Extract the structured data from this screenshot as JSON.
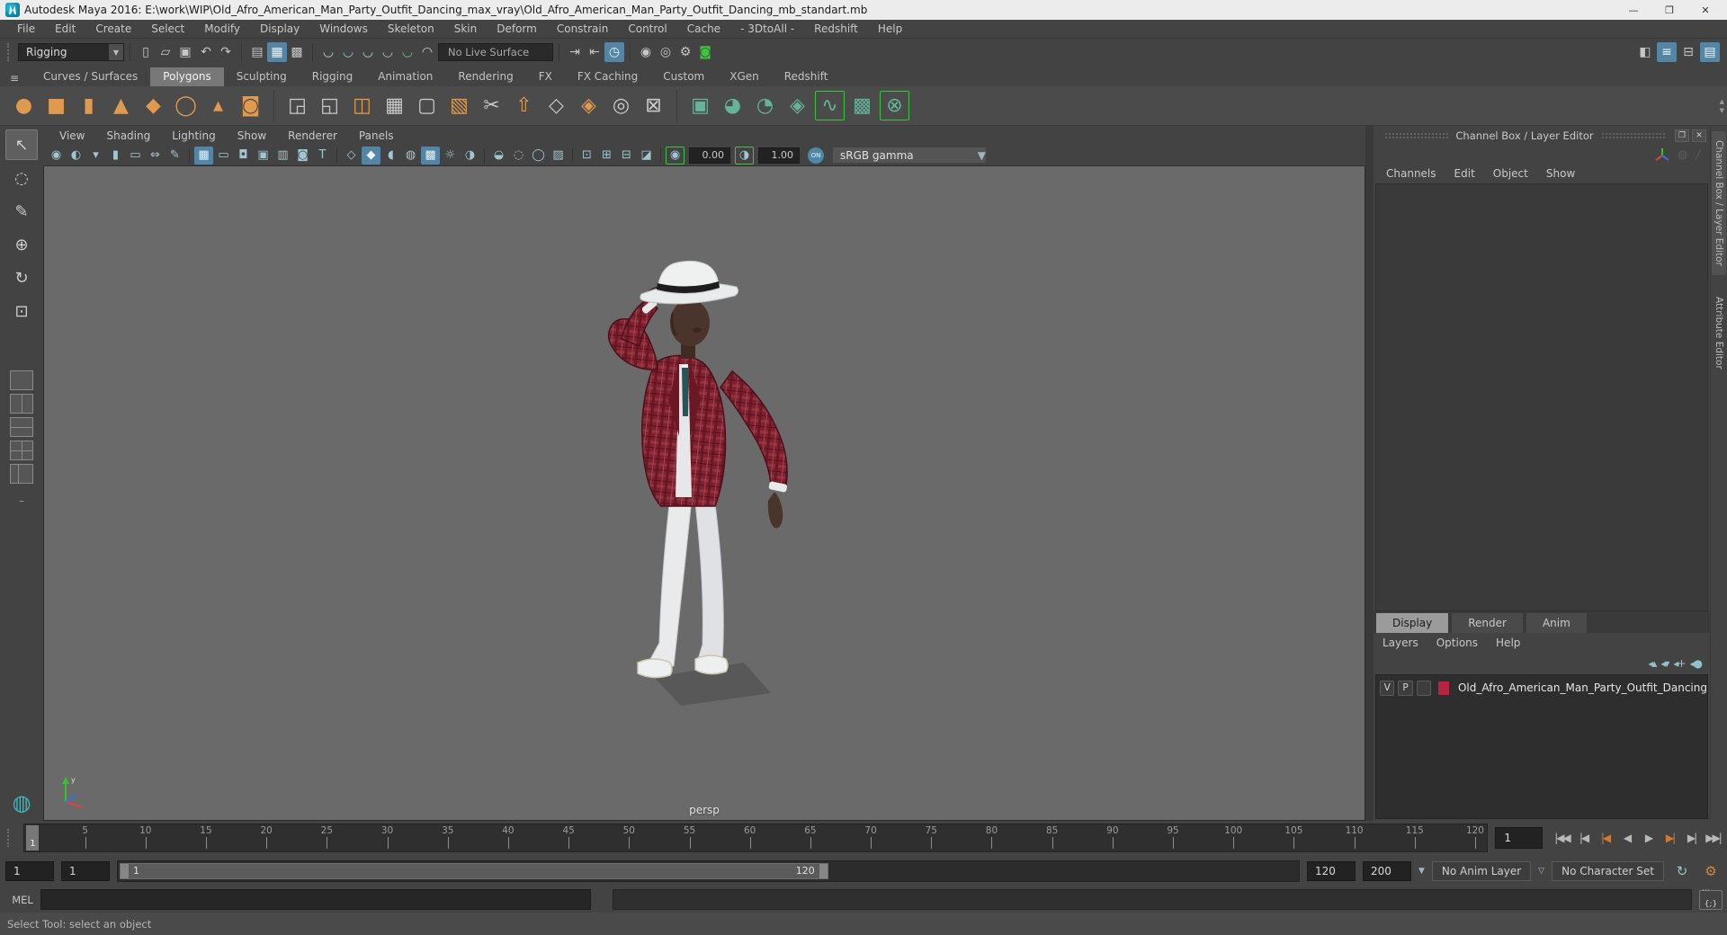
{
  "window": {
    "title": "Autodesk Maya 2016: E:\\work\\WIP\\Old_Afro_American_Man_Party_Outfit_Dancing_max_vray\\Old_Afro_American_Man_Party_Outfit_Dancing_mb_standart.mb",
    "minimize": "—",
    "maximize": "❐",
    "close": "✕"
  },
  "menubar": {
    "items": [
      "File",
      "Edit",
      "Create",
      "Select",
      "Modify",
      "Display",
      "Windows",
      "Skeleton",
      "Skin",
      "Deform",
      "Constrain",
      "Control",
      "Cache",
      "- 3DtoAll -",
      "Redshift",
      "Help"
    ]
  },
  "statusline": {
    "menu_set": "Rigging",
    "live_surface": "No Live Surface",
    "file_icons": [
      {
        "name": "new-scene-icon",
        "glyph": "▯"
      },
      {
        "name": "open-scene-icon",
        "glyph": "▱"
      },
      {
        "name": "save-scene-icon",
        "glyph": "▣"
      }
    ],
    "history_icons": [
      {
        "name": "undo-icon",
        "glyph": "↶"
      },
      {
        "name": "redo-icon",
        "glyph": "↷"
      }
    ],
    "selection_icons": [
      {
        "name": "select-hierarchy-icon",
        "glyph": "▤"
      },
      {
        "name": "select-object-icon",
        "glyph": "▦",
        "active": true
      },
      {
        "name": "select-component-icon",
        "glyph": "▩"
      }
    ],
    "snap_icons": [
      {
        "name": "snap-grid-icon",
        "glyph": "◡",
        "color": "#bcd3da"
      },
      {
        "name": "snap-curve-icon",
        "glyph": "◡",
        "color": "#8fc3cf"
      },
      {
        "name": "snap-point-icon",
        "glyph": "◡",
        "color": "#bcd3da"
      },
      {
        "name": "snap-projected-center-icon",
        "glyph": "◡",
        "color": "#9fc0cc"
      },
      {
        "name": "snap-view-plane-icon",
        "glyph": "◡",
        "color": "#6fbf8f"
      },
      {
        "name": "make-live-icon",
        "glyph": "◠",
        "color": "#bcd3da"
      }
    ],
    "connection_icons": [
      {
        "name": "input-connections-icon",
        "glyph": "⇥"
      },
      {
        "name": "output-connections-icon",
        "glyph": "⇤"
      },
      {
        "name": "construction-history-icon",
        "glyph": "◷",
        "active": true
      }
    ],
    "render_icons": [
      {
        "name": "render-frame-icon",
        "glyph": "◉"
      },
      {
        "name": "ipr-render-icon",
        "glyph": "◎"
      },
      {
        "name": "render-settings-icon",
        "glyph": "⚙"
      },
      {
        "name": "redshift-renderview-icon",
        "glyph": "◙",
        "color": "#3ec43e"
      }
    ],
    "sidebar_icons": [
      {
        "name": "modeling-toolkit-toggle-icon",
        "glyph": "◧"
      },
      {
        "name": "channel-box-toggle-icon",
        "glyph": "≡",
        "active": true
      },
      {
        "name": "attribute-editor-toggle-icon",
        "glyph": "⊟"
      },
      {
        "name": "tool-settings-toggle-icon",
        "glyph": "▤",
        "active": true
      }
    ]
  },
  "shelf": {
    "tabs": [
      {
        "label": "Curves / Surfaces"
      },
      {
        "label": "Polygons",
        "active": true
      },
      {
        "label": "Sculpting"
      },
      {
        "label": "Rigging"
      },
      {
        "label": "Animation"
      },
      {
        "label": "Rendering"
      },
      {
        "label": "FX"
      },
      {
        "label": "FX Caching"
      },
      {
        "label": "Custom"
      },
      {
        "label": "XGen"
      },
      {
        "label": "Redshift"
      }
    ],
    "primitives": [
      {
        "name": "poly-sphere-icon",
        "glyph": "●",
        "color": "#e09a4f"
      },
      {
        "name": "poly-cube-icon",
        "glyph": "■",
        "color": "#e09a4f"
      },
      {
        "name": "poly-cylinder-icon",
        "glyph": "▮",
        "color": "#e09a4f"
      },
      {
        "name": "poly-cone-icon",
        "glyph": "▲",
        "color": "#e09a4f"
      },
      {
        "name": "poly-plane-icon",
        "glyph": "◆",
        "color": "#e09a4f"
      },
      {
        "name": "poly-torus-icon",
        "glyph": "◯",
        "color": "#e09a4f"
      },
      {
        "name": "poly-pyramid-icon",
        "glyph": "▴",
        "color": "#e09a4f"
      },
      {
        "name": "poly-pipe-icon",
        "glyph": "◙",
        "color": "#e09a4f"
      }
    ],
    "modeling": [
      {
        "name": "combine-icon",
        "glyph": "◲",
        "color": "#c9c9c9"
      },
      {
        "name": "separate-icon",
        "glyph": "◱",
        "color": "#c9c9c9"
      },
      {
        "name": "mirror-icon",
        "glyph": "◫",
        "color": "#e09a4f"
      },
      {
        "name": "smooth-icon",
        "glyph": "▦",
        "color": "#c9c9c9"
      },
      {
        "name": "subdiv-proxy-icon",
        "glyph": "▢",
        "color": "#c9c9c9"
      },
      {
        "name": "reduce-icon",
        "glyph": "▧",
        "color": "#e09a4f"
      },
      {
        "name": "multi-cut-icon",
        "glyph": "✂",
        "color": "#c9c9c9"
      },
      {
        "name": "extrude-icon",
        "glyph": "⇧",
        "color": "#e09a4f"
      },
      {
        "name": "quad-draw-icon",
        "glyph": "◇",
        "color": "#c9c9c9"
      },
      {
        "name": "bevel-icon",
        "glyph": "◈",
        "color": "#e09a4f"
      },
      {
        "name": "target-weld-icon",
        "glyph": "◎",
        "color": "#c9c9c9"
      },
      {
        "name": "delete-edge-icon",
        "glyph": "⊠",
        "color": "#c9c9c9"
      }
    ],
    "uv": [
      {
        "name": "planar-mapping-icon",
        "glyph": "▣",
        "color": "#66b39b"
      },
      {
        "name": "cylindrical-mapping-icon",
        "glyph": "◕",
        "color": "#66b39b"
      },
      {
        "name": "spherical-mapping-icon",
        "glyph": "◔",
        "color": "#66b39b"
      },
      {
        "name": "automatic-mapping-icon",
        "glyph": "◈",
        "color": "#66b39b"
      },
      {
        "name": "unfold-uv-icon",
        "glyph": "∿",
        "color": "#66b39b",
        "frame": "#3ec43e"
      },
      {
        "name": "uv-editor-icon",
        "glyph": "▩",
        "color": "#66b39b"
      },
      {
        "name": "cut-sew-uv-icon",
        "glyph": "⊗",
        "color": "#66b39b",
        "frame": "#3ec43e"
      }
    ]
  },
  "toolbox": {
    "tools": [
      {
        "name": "select-tool",
        "glyph": "↖",
        "active": true
      },
      {
        "name": "lasso-tool",
        "glyph": "◌"
      },
      {
        "name": "paint-select-tool",
        "glyph": "✎"
      },
      {
        "name": "move-tool",
        "glyph": "⊕"
      },
      {
        "name": "rotate-tool",
        "glyph": "↻"
      },
      {
        "name": "scale-tool",
        "glyph": "⊡"
      }
    ]
  },
  "viewport": {
    "menus": [
      "View",
      "Shading",
      "Lighting",
      "Show",
      "Renderer",
      "Panels"
    ],
    "icons_camera": [
      {
        "name": "select-camera-icon",
        "glyph": "◉"
      },
      {
        "name": "lock-camera-icon",
        "glyph": "◐"
      },
      {
        "name": "camera-attributes-icon",
        "glyph": "▾"
      },
      {
        "name": "bookmark-icon",
        "glyph": "▮"
      },
      {
        "name": "image-plane-icon",
        "glyph": "▭"
      },
      {
        "name": "two-d-pan-zoom-icon",
        "glyph": "⇔"
      },
      {
        "name": "grease-pencil-icon",
        "glyph": "✎"
      }
    ],
    "icons_gates": [
      {
        "name": "grid-icon",
        "glyph": "▦",
        "active": true
      },
      {
        "name": "film-gate-icon",
        "glyph": "▭"
      },
      {
        "name": "resolution-gate-icon",
        "glyph": "◘"
      },
      {
        "name": "gate-mask-icon",
        "glyph": "▣"
      },
      {
        "name": "field-chart-icon",
        "glyph": "▥"
      },
      {
        "name": "safe-action-icon",
        "glyph": "◙"
      },
      {
        "name": "safe-title-icon",
        "glyph": "T"
      }
    ],
    "icons_shading": [
      {
        "name": "wireframe-icon",
        "glyph": "◇"
      },
      {
        "name": "shaded-icon",
        "glyph": "◆",
        "active": true
      },
      {
        "name": "use-default-material-icon",
        "glyph": "◖"
      },
      {
        "name": "xray-icon",
        "glyph": "◍"
      },
      {
        "name": "textured-icon",
        "glyph": "▩",
        "active": true
      },
      {
        "name": "lights-icon",
        "glyph": "☼"
      },
      {
        "name": "shadows-icon",
        "glyph": "◑"
      }
    ],
    "icons_effects": [
      {
        "name": "occlusion-icon",
        "glyph": "◒"
      },
      {
        "name": "motion-blur-icon",
        "glyph": "◌"
      },
      {
        "name": "multisample-icon",
        "glyph": "◯"
      },
      {
        "name": "depth-peeling-icon",
        "glyph": "▨"
      }
    ],
    "icons_misc": [
      {
        "name": "isolate-select-icon",
        "glyph": "⊡"
      },
      {
        "name": "tearoff-copy-icon",
        "glyph": "⊞"
      },
      {
        "name": "pane-layout-icon",
        "glyph": "⊟"
      },
      {
        "name": "viewport-options-icon",
        "glyph": "◪"
      }
    ],
    "exposure_value": "0.00",
    "gamma_value": "1.00",
    "on_toggle": "ON",
    "view_transform": "sRGB gamma",
    "camera_label": "persp"
  },
  "channel_box": {
    "title": "Channel Box / Layer Editor",
    "float_btn": "❐",
    "close_btn": "✕",
    "menus": [
      "Channels",
      "Edit",
      "Object",
      "Show"
    ],
    "side_tabs": [
      {
        "label": "Channel Box / Layer Editor",
        "active": true
      },
      {
        "label": "Attribute Editor"
      }
    ]
  },
  "layer_editor": {
    "tabs": [
      {
        "label": "Display",
        "active": true
      },
      {
        "label": "Render"
      },
      {
        "label": "Anim"
      }
    ],
    "menus": [
      "Layers",
      "Options",
      "Help"
    ],
    "icons": [
      {
        "name": "move-layer-up-icon",
        "glyph": "◂▴"
      },
      {
        "name": "move-layer-down-icon",
        "glyph": "◂▾"
      },
      {
        "name": "add-layer-icon",
        "glyph": "◂+"
      },
      {
        "name": "add-layer-selected-icon",
        "glyph": "◂●"
      }
    ],
    "layer": {
      "visibility": "V",
      "playback": "P",
      "color": "#b8233f",
      "name": "Old_Afro_American_Man_Party_Outfit_Dancing"
    }
  },
  "timeline": {
    "current_frame": "1",
    "end": 120,
    "labels": [
      "5",
      "10",
      "15",
      "20",
      "25",
      "30",
      "35",
      "40",
      "45",
      "50",
      "55",
      "60",
      "65",
      "70",
      "75",
      "80",
      "85",
      "90",
      "95",
      "100",
      "105",
      "110",
      "115",
      "120"
    ],
    "current_frame_field": "1"
  },
  "playback": {
    "buttons": [
      {
        "name": "go-to-start-button",
        "glyph": "|◀◀"
      },
      {
        "name": "step-back-frame-button",
        "glyph": "|◀"
      },
      {
        "name": "step-back-key-button",
        "glyph": "|◀",
        "color": "#cf7a33"
      },
      {
        "name": "play-backwards-button",
        "glyph": "◀"
      },
      {
        "name": "play-forwards-button",
        "glyph": "▶"
      },
      {
        "name": "step-forward-key-button",
        "glyph": "▶|",
        "color": "#cf7a33"
      },
      {
        "name": "step-forward-frame-button",
        "glyph": "▶|"
      },
      {
        "name": "go-to-end-button",
        "glyph": "▶▶|"
      }
    ]
  },
  "range_slider": {
    "anim_start": "1",
    "playback_start": "1",
    "range_bar_start": "1",
    "range_bar_end": "120",
    "playback_end": "120",
    "anim_end": "200",
    "anim_layer": "No Anim Layer",
    "character_set": "No Character Set"
  },
  "command_line": {
    "label": "MEL",
    "script_editor_glyph": "{;}"
  },
  "help_line": {
    "text": "Select Tool: select an object"
  },
  "colors": {
    "accent_blue": "#5285a6",
    "shelf_orange": "#e09a4f",
    "uv_teal": "#66b39b",
    "key_orange": "#cf7a33",
    "layer_swatch": "#b8233f",
    "viewport_bg": "#6a6a6a"
  }
}
